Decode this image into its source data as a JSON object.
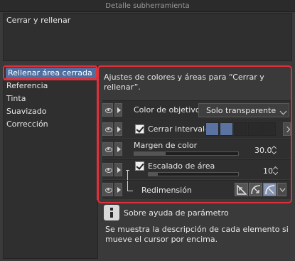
{
  "window": {
    "title": "Detalle subherramienta"
  },
  "tool_name": "Cerrar y rellenar",
  "categories": [
    {
      "label": "Rellenar área cerrada",
      "selected": true
    },
    {
      "label": "Referencia",
      "selected": false
    },
    {
      "label": "Tinta",
      "selected": false
    },
    {
      "label": "Suavizado",
      "selected": false
    },
    {
      "label": "Corrección",
      "selected": false
    }
  ],
  "panel": {
    "description": "Ajustes de colores y áreas para “Cerrar y rellenar”.",
    "target_color": {
      "label": "Color de objetivo",
      "value": "Solo transparente"
    },
    "close_gap": {
      "label": "Cerrar intervalo",
      "checked": true,
      "selected_swatches": 2,
      "total_swatches": 5
    },
    "color_margin": {
      "label": "Margen de color",
      "value": "30.0",
      "fill_fraction": 0.3
    },
    "area_scaling": {
      "label": "Escalado de área",
      "checked": true,
      "value": "10",
      "fill_fraction": 0.1
    },
    "resize": {
      "label": "Redimensión",
      "active_mode": 3
    }
  },
  "help": {
    "title": "Sobre ayuda de parámetro",
    "text": "Se muestra la descripción de cada elemento si mueve el cursor por encima."
  },
  "colors": {
    "highlight_red": "#e0303a",
    "selection_blue": "#4e6fa0",
    "swatch_active": "#5a73a0"
  }
}
